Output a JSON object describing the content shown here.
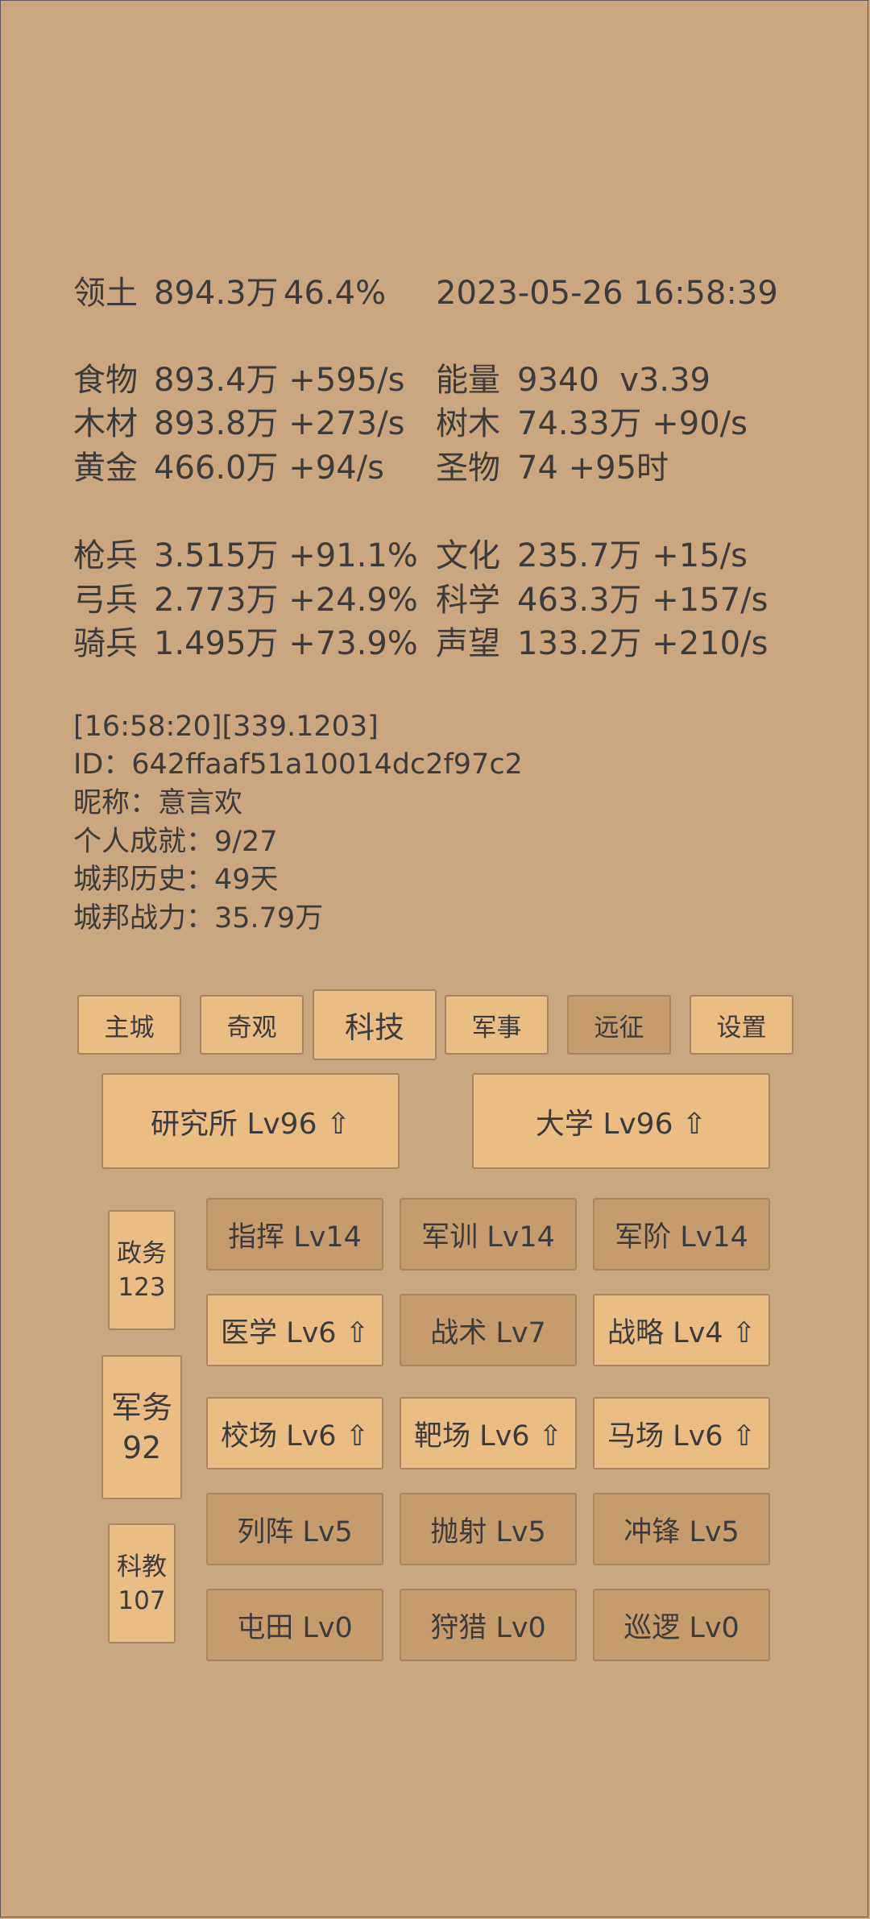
{
  "stats": {
    "territory": {
      "label": "领土",
      "value": "894.3万",
      "extra": "46.4%"
    },
    "datetime": "2023-05-26 16:58:39",
    "left_rows": [
      {
        "label": "食物",
        "value": "893.4万 +595/s"
      },
      {
        "label": "木材",
        "value": "893.8万 +273/s"
      },
      {
        "label": "黄金",
        "value": "466.0万 +94/s"
      },
      {
        "label": "枪兵",
        "value": "3.515万 +91.1%"
      },
      {
        "label": "弓兵",
        "value": "2.773万 +24.9%"
      },
      {
        "label": "骑兵",
        "value": "1.495万 +73.9%"
      }
    ],
    "right_rows": [
      {
        "label": "能量",
        "value": "9340  v3.39"
      },
      {
        "label": "树木",
        "value": "74.33万 +90/s"
      },
      {
        "label": "圣物",
        "value": "74 +95时"
      },
      {
        "label": "文化",
        "value": "235.7万 +15/s"
      },
      {
        "label": "科学",
        "value": "463.3万 +157/s"
      },
      {
        "label": "声望",
        "value": "133.2万 +210/s"
      }
    ]
  },
  "info": {
    "log_line": "[16:58:20][339.1203]",
    "id_line": "ID：642ffaaf51a10014dc2f97c2",
    "nickname_line": "昵称：意言欢",
    "achievement_line": "个人成就：9/27",
    "history_line": "城邦历史：49天",
    "power_line": "城邦战力：35.79万"
  },
  "tabs": [
    {
      "label": "主城"
    },
    {
      "label": "奇观"
    },
    {
      "label": "科技"
    },
    {
      "label": "军事"
    },
    {
      "label": "远征"
    },
    {
      "label": "设置"
    }
  ],
  "buildings": {
    "institute": "研究所 Lv96 ⇧",
    "university": "大学 Lv96 ⇧"
  },
  "side_panel": {
    "politics": {
      "label": "政务",
      "value": "123"
    },
    "military": {
      "label": "军务",
      "value": "92"
    },
    "education": {
      "label": "科教",
      "value": "107"
    }
  },
  "tech_rows": [
    [
      "指挥 Lv14",
      "军训 Lv14",
      "军阶 Lv14"
    ],
    [
      "医学 Lv6 ⇧",
      "战术 Lv7",
      "战略 Lv4 ⇧"
    ],
    [
      "校场 Lv6 ⇧",
      "靶场 Lv6 ⇧",
      "马场 Lv6 ⇧"
    ],
    [
      "列阵 Lv5",
      "抛射 Lv5",
      "冲锋 Lv5"
    ],
    [
      "屯田 Lv0",
      "狩猎 Lv0",
      "巡逻 Lv0"
    ]
  ],
  "colors": {
    "background": "#cba780",
    "button_light": "#ebbd85",
    "button_dark": "#c79c6c",
    "text": "#3b3b3b"
  }
}
